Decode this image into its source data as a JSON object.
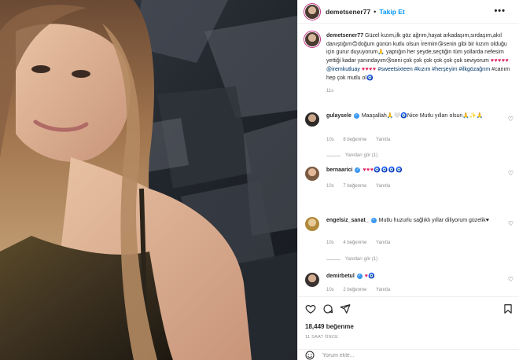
{
  "post": {
    "username": "demetsener77",
    "follow_label": "Takip Et",
    "more_label": "•••",
    "dot": "•"
  },
  "caption": {
    "username": "demetsener77",
    "part1": "Güzel kızım,ilk göz ağrım,hayat arkadaşım,sırdaşım,akıl danıştığım😊doğum günün kutlu olsun İremim😘senin gibi bir kızım olduğu için gurur duyuyorum🙏 yaptığın her şeyde,seçtiğin tüm yollarda nefesim yettiği kadar yanındayım😘seni çok çok çok çok çok çok seviyorum",
    "hearts": "♥♥♥♥♥",
    "mention": "@iremkutluay",
    "hearts2": "♥♥♥♥",
    "hashtags": "#sweetsixteen #kızım #herşeyim #ilkgözağrım",
    "part2": "#canım hep çok mutlu ol🧿",
    "time": "11s"
  },
  "comments": [
    {
      "username": "gulaysele",
      "text": "Maaşallah🙏🤍🧿Nice Mutlu yılları olsun🙏✨🙏",
      "time": "10s",
      "likes": "8 beğenme",
      "reply": "Yanıtla",
      "view_replies": "Yanıtları gör (1)"
    },
    {
      "username": "bernaarici",
      "text": "♥♥♥🧿🧿🧿🧿",
      "time": "10s",
      "likes": "7 beğenme",
      "reply": "Yanıtla"
    },
    {
      "username": "engelsiz_sanat_",
      "text": "Mutlu huzurlu sağlıklı yıllar diliyorum güzelik♥",
      "time": "10s",
      "likes": "4 beğenme",
      "reply": "Yanıtla",
      "view_replies": "Yanıtları gör (1)"
    },
    {
      "username": "demirbetul",
      "text": "♥🧿",
      "time": "10s",
      "likes": "2 beğenme",
      "reply": "Yanıtla"
    }
  ],
  "footer": {
    "likes": "18,449 beğenme",
    "ago": "11 SAAT ÖNCE",
    "comment_placeholder": "Yorum ekle..."
  },
  "icons": {
    "like": "heart-icon",
    "comment": "comment-icon",
    "share": "share-icon",
    "save": "bookmark-icon",
    "emoji": "emoji-icon"
  },
  "colors": {
    "link": "#0095f6",
    "hashtag": "#00376b",
    "muted": "#8e8e8e",
    "heart": "#e0245e",
    "verified": "#3897f0"
  }
}
